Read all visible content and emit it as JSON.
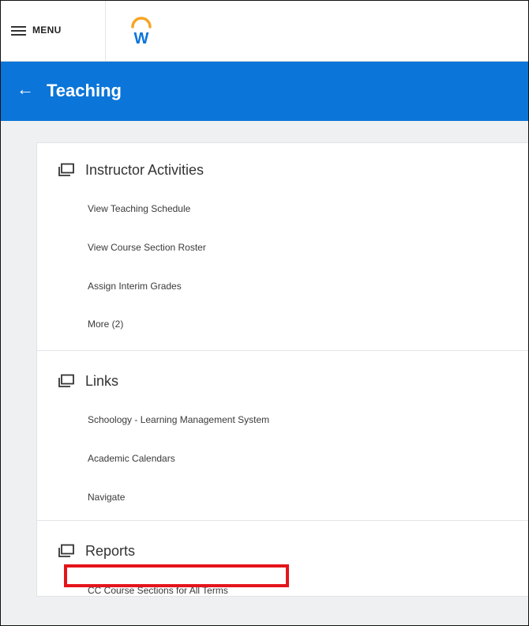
{
  "topbar": {
    "menu_label": "MENU",
    "logo_letter": "W",
    "logo_arc_color": "#f5a623",
    "logo_letter_color": "#0b75d9"
  },
  "header": {
    "back_glyph": "←",
    "title": "Teaching",
    "color": "#0b75d9"
  },
  "sections": [
    {
      "title": "Instructor Activities",
      "icon": "window-stack-icon",
      "links": [
        "View Teaching Schedule",
        "View Course Section Roster",
        "Assign Interim Grades",
        "More (2)"
      ]
    },
    {
      "title": "Links",
      "icon": "window-stack-icon",
      "links": [
        "Schoology - Learning Management System",
        "Academic Calendars",
        "Navigate"
      ]
    },
    {
      "title": "Reports",
      "icon": "window-stack-icon",
      "links": [
        "CC Course Sections for All Terms"
      ]
    }
  ],
  "highlight_color": "#e5141b"
}
